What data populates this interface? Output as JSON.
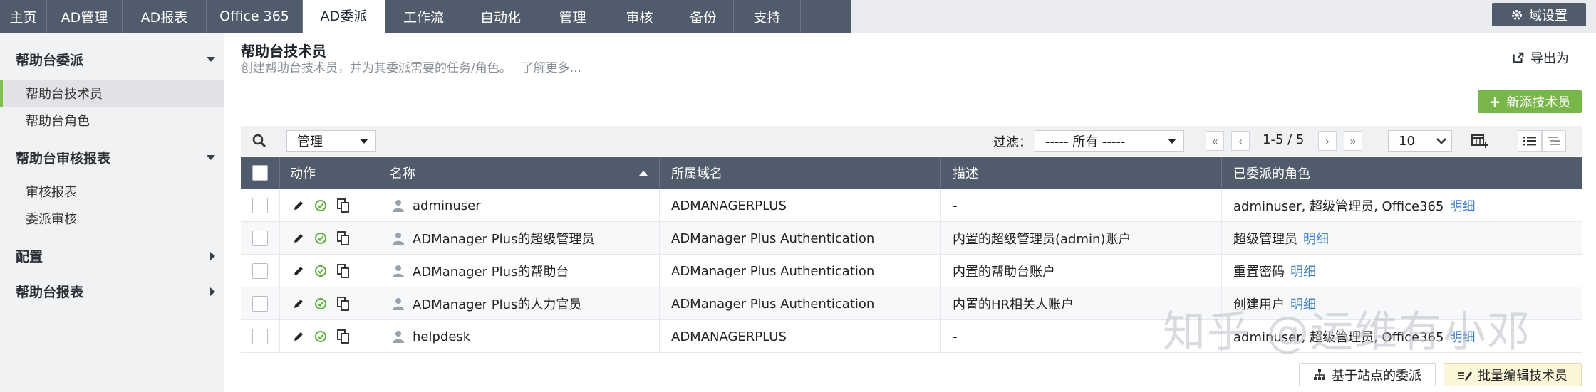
{
  "nav": {
    "tabs": [
      "主页",
      "AD管理",
      "AD报表",
      "Office 365",
      "AD委派",
      "工作流",
      "自动化",
      "管理",
      "审核",
      "备份",
      "支持"
    ],
    "active_tab": "AD委派",
    "domain_settings": "域设置"
  },
  "sidebar": {
    "sections": [
      {
        "title": "帮助台委派",
        "expanded": true
      },
      {
        "title": "帮助台审核报表",
        "expanded": true
      },
      {
        "title": "配置",
        "expanded": false
      },
      {
        "title": "帮助台报表",
        "expanded": false
      }
    ],
    "items": [
      {
        "label": "帮助台技术员",
        "active": true
      },
      {
        "label": "帮助台角色",
        "active": false
      },
      {
        "label": "审核报表",
        "active": false
      },
      {
        "label": "委派审核",
        "active": false
      }
    ]
  },
  "page": {
    "title": "帮助台技术员",
    "description": "创建帮助台技术员，并为其委派需要的任务/角色。",
    "learn_more": "了解更多...",
    "export": "导出为",
    "new_tech": "新添技术员"
  },
  "toolbar": {
    "search_icon": "search-icon",
    "manage_select": "管理",
    "filter_label": "过滤：",
    "filter_select": "----- 所有 -----",
    "page_range": "1-5 / 5",
    "page_size": "10"
  },
  "table": {
    "columns": [
      "动作",
      "名称",
      "所属域名",
      "描述",
      "已委派的角色"
    ],
    "detail_link": "明细",
    "rows": [
      {
        "name": "adminuser",
        "domain": "ADMANAGERPLUS",
        "desc": "-",
        "roles": "adminuser, 超级管理员, Office365"
      },
      {
        "name": "ADManager Plus的超级管理员",
        "domain": "ADManager Plus Authentication",
        "desc": "内置的超级管理员(admin)账户",
        "roles": "超级管理员"
      },
      {
        "name": "ADManager Plus的帮助台",
        "domain": "ADManager Plus Authentication",
        "desc": "内置的帮助台账户",
        "roles": "重置密码"
      },
      {
        "name": "ADManager Plus的人力官员",
        "domain": "ADManager Plus Authentication",
        "desc": "内置的HR相关人账户",
        "roles": "创建用户"
      },
      {
        "name": "helpdesk",
        "domain": "ADMANAGERPLUS",
        "desc": "-",
        "roles": "adminuser, 超级管理员, Office365"
      }
    ]
  },
  "footer": {
    "site_delegation": "基于站点的委派",
    "bulk_edit": "批量编辑技术员"
  },
  "watermark": "知乎 @运维有小邓",
  "colors": {
    "accent_green": "#79b64a",
    "header_dark": "#505b6b",
    "link_blue": "#3d7fbf"
  }
}
